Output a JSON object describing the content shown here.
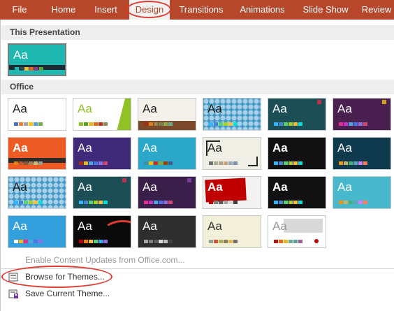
{
  "ribbon": {
    "tabs": [
      {
        "label": "File"
      },
      {
        "label": "Home"
      },
      {
        "label": "Insert"
      },
      {
        "label": "Design",
        "active": true
      },
      {
        "label": "Transitions"
      },
      {
        "label": "Animations"
      },
      {
        "label": "Slide Show"
      },
      {
        "label": "Review"
      }
    ],
    "background_color": "#b7472a",
    "highlight_color": "#e03c31"
  },
  "sections": {
    "this_presentation": "This Presentation",
    "office": "Office"
  },
  "themes": {
    "sample_text": "Aa",
    "current": {
      "style": "teal"
    },
    "office": [
      {
        "style": "office-theme"
      },
      {
        "style": "facet"
      },
      {
        "style": "wood"
      },
      {
        "style": "pattern"
      },
      {
        "style": "dark-teal"
      },
      {
        "style": "purple"
      },
      {
        "style": "orange-bar"
      },
      {
        "style": "purple-blue"
      },
      {
        "style": "cyan"
      },
      {
        "style": "frame"
      },
      {
        "style": "black"
      },
      {
        "style": "dark-cyan"
      },
      {
        "style": "pattern"
      },
      {
        "style": "dark-teal"
      },
      {
        "style": "purple-dark"
      },
      {
        "style": "red"
      },
      {
        "style": "black"
      },
      {
        "style": "light-cyan"
      },
      {
        "style": "blue-ion"
      },
      {
        "style": "ribbon-black"
      },
      {
        "style": "charcoal"
      },
      {
        "style": "sand"
      },
      {
        "style": "stamp"
      }
    ]
  },
  "menu": {
    "items": [
      {
        "label": "Enable Content Updates from Office.com...",
        "enabled": false,
        "icon": "none"
      },
      {
        "label": "Browse for Themes...",
        "enabled": true,
        "icon": "browse-themes-icon"
      },
      {
        "label": "Save Current Theme...",
        "enabled": true,
        "icon": "save-theme-icon"
      }
    ]
  }
}
